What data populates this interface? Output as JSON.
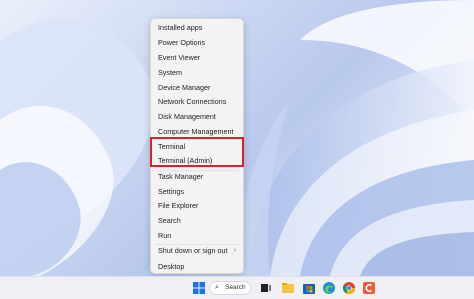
{
  "menu": {
    "items": [
      {
        "label": "Installed apps"
      },
      {
        "label": "Power Options"
      },
      {
        "label": "Event Viewer"
      },
      {
        "label": "System"
      },
      {
        "label": "Device Manager"
      },
      {
        "label": "Network Connections"
      },
      {
        "label": "Disk Management"
      },
      {
        "label": "Computer Management"
      },
      {
        "label": "Terminal"
      },
      {
        "label": "Terminal (Admin)"
      },
      {
        "label": "Task Manager"
      },
      {
        "label": "Settings"
      },
      {
        "label": "File Explorer"
      },
      {
        "label": "Search"
      },
      {
        "label": "Run"
      },
      {
        "label": "Shut down or sign out",
        "has_submenu": true
      },
      {
        "label": "Desktop"
      }
    ],
    "highlight_color": "#d8232a"
  },
  "taskbar": {
    "search_label": "Search",
    "icons": [
      "windows-start-icon",
      "search-icon",
      "task-view-icon",
      "file-explorer-icon",
      "microsoft-store-icon",
      "edge-icon",
      "chrome-icon",
      "app-icon"
    ]
  }
}
